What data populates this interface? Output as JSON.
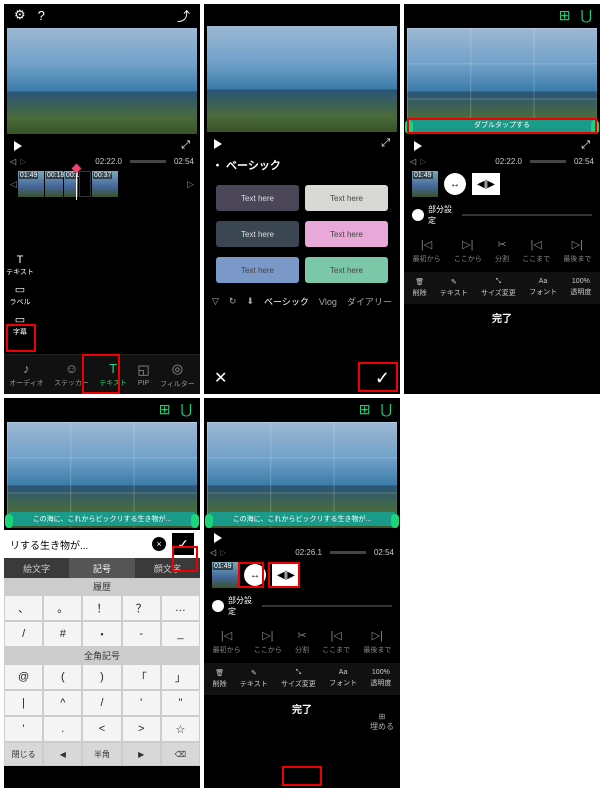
{
  "p1": {
    "time_current": "02:22.0",
    "time_total": "02:54",
    "thumbs": [
      "01:49",
      "00:18",
      "00:10",
      "",
      "00:37"
    ],
    "side": {
      "text": "テキスト",
      "label": "ラベル",
      "subtitle": "字幕"
    },
    "bottom": {
      "audio": "オーディオ",
      "sticker": "ステッカー",
      "text": "テキスト",
      "pip": "PIP",
      "filter": "フィルター"
    }
  },
  "p2": {
    "title": "・ ベーシック",
    "chips": [
      "Text here",
      "Text here",
      "Text here",
      "Text here",
      "Text here",
      "Text here"
    ],
    "tabs": [
      "ベーシック",
      "Vlog",
      "ダイアリー"
    ]
  },
  "p3": {
    "caption": "ダブルタップする",
    "time_current": "02:22.0",
    "time_total": "02:54",
    "thumb": "01:49",
    "partial": "部分設\n定",
    "range": {
      "start": "最初から",
      "here": "ここから",
      "split": "分割",
      "to": "ここまで",
      "end": "最後まで"
    },
    "edit": {
      "delete": "削除",
      "text": "テキスト",
      "resize": "サイズ変更",
      "font": "フォント",
      "opacity": "100%",
      "opacity_label": "透明度"
    },
    "done": "完了"
  },
  "p4": {
    "caption": "この海に、これからビックリする生き物が...",
    "input": "リする生き物が...",
    "kbd_tabs": {
      "emoji": "絵文字",
      "symbol": "記号",
      "kaomoji": "顔文字"
    },
    "history": "履歴",
    "fullwidth": "全角記号",
    "row1": [
      "、",
      "。",
      "！",
      "？",
      "…"
    ],
    "row2": [
      "/",
      "#",
      "・",
      "-",
      "_"
    ],
    "row3": [
      "@",
      "(",
      ")",
      "「",
      "」"
    ],
    "row4": [
      "|",
      "^",
      "/",
      "'",
      "\""
    ],
    "row5": [
      "'",
      ".",
      "<",
      ">",
      "☆"
    ],
    "bot": {
      "close": "閉じる",
      "left": "◀",
      "half": "半角",
      "right": "▶",
      "del": "⌫"
    }
  },
  "p5": {
    "caption": "この海に、これからビックリする生き物が...",
    "time_current": "02:26.1",
    "time_total": "02:54",
    "thumb": "01:49",
    "partial": "部分設\n定",
    "fill": "埋める",
    "range": {
      "start": "最初から",
      "here": "ここから",
      "split": "分割",
      "to": "ここまで",
      "end": "最後まで"
    },
    "edit": {
      "delete": "削除",
      "text": "テキスト",
      "resize": "サイズ変更",
      "font": "フォント",
      "opacity": "100%",
      "opacity_label": "透明度"
    },
    "done": "完了"
  }
}
